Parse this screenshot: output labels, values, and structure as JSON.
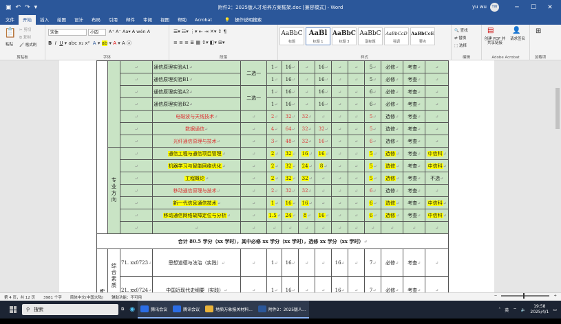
{
  "titlebar": {
    "title": "附件2：2025版人才培养方案框架.doc [兼容模式] - Word",
    "user": "yu wu",
    "avatar": "YW",
    "quick_icons": [
      "save-icon",
      "undo-icon",
      "redo-icon",
      "customize-icon"
    ]
  },
  "tabs": [
    "文件",
    "开始",
    "插入",
    "绘图",
    "设计",
    "布局",
    "引用",
    "邮件",
    "审阅",
    "视图",
    "帮助",
    "Acrobat"
  ],
  "active_tab": "开始",
  "tell_me": "操作说明搜索",
  "ribbon": {
    "clipboard": {
      "paste": "粘贴",
      "cut": "剪切",
      "copy": "复制",
      "format_painter": "格式刷",
      "label": "剪贴板"
    },
    "font": {
      "family": "宋体",
      "size": "小四",
      "label": "字体"
    },
    "paragraph": {
      "label": "段落"
    },
    "styles": {
      "items": [
        {
          "preview": "AaBbC",
          "name": "标题"
        },
        {
          "preview": "AaBl",
          "name": "标题 1"
        },
        {
          "preview": "AaBbC",
          "name": "标题 3"
        },
        {
          "preview": "AaBbC",
          "name": "副标题"
        },
        {
          "preview": "AaBbCcD",
          "name": "强调"
        },
        {
          "preview": "AaBbCcE",
          "name": "要点"
        }
      ],
      "label": "样式"
    },
    "editing": {
      "find": "查找",
      "replace": "替换",
      "select": "选择",
      "label": "编辑"
    },
    "acrobat": {
      "create": "创建 PDF 并共享链接",
      "request": "请求签名",
      "label": "Adobe Acrobat"
    },
    "addins": {
      "label": "加载项"
    }
  },
  "table_rows": [
    {
      "course": "通信原理实验A1",
      "note": "二选一",
      "a": "1",
      "b": "16",
      "c": "",
      "d": "16",
      "e": "",
      "f": "",
      "g": "5",
      "type": "必修",
      "exam": "考查",
      "x": "",
      "color": "dark"
    },
    {
      "course": "通信原理实验B1",
      "note": "",
      "a": "1",
      "b": "16",
      "c": "",
      "d": "16",
      "e": "",
      "f": "",
      "g": "5",
      "type": "必修",
      "exam": "考查",
      "x": "",
      "color": "dark"
    },
    {
      "course": "通信原理实验A2",
      "note": "二选一",
      "a": "1",
      "b": "16",
      "c": "",
      "d": "16",
      "e": "",
      "f": "",
      "g": "6",
      "type": "必修",
      "exam": "考查",
      "x": "",
      "color": "dark"
    },
    {
      "course": "通信原理实验B2",
      "note": "",
      "a": "1",
      "b": "16",
      "c": "",
      "d": "16",
      "e": "",
      "f": "",
      "g": "6",
      "type": "必修",
      "exam": "考查",
      "x": "",
      "color": "dark"
    },
    {
      "course": "电磁波与天线技术",
      "note": "",
      "a": "2",
      "b": "32",
      "c": "32",
      "d": "",
      "e": "",
      "f": "",
      "g": "5",
      "type": "选修",
      "exam": "考查",
      "x": "",
      "color": "red"
    },
    {
      "course": "数据通信",
      "note": "",
      "a": "4",
      "b": "64",
      "c": "32",
      "d": "32",
      "e": "",
      "f": "",
      "g": "5",
      "type": "选修",
      "exam": "考查",
      "x": "",
      "color": "red"
    },
    {
      "course": "光纤通信原理与技术",
      "note": "",
      "a": "3",
      "b": "48",
      "c": "32",
      "d": "16",
      "e": "",
      "f": "",
      "g": "6",
      "type": "选修",
      "exam": "考查",
      "x": "",
      "color": "red"
    },
    {
      "course": "通信工程与通信项目管理",
      "note": "",
      "a": "2",
      "b": "32",
      "c": "16",
      "d": "16",
      "e": "",
      "f": "",
      "g": "5",
      "type": "选修",
      "exam": "考查",
      "x": "中信科",
      "color": "hl"
    },
    {
      "course": "机器学习与智能网络优化",
      "note": "",
      "a": "2",
      "b": "32",
      "c": "24",
      "d": "8",
      "e": "",
      "f": "",
      "g": "5",
      "type": "选修",
      "exam": "考查",
      "x": "中信科",
      "color": "hl"
    },
    {
      "course": "工程概论",
      "note": "",
      "a": "2",
      "b": "32",
      "c": "32",
      "d": "",
      "e": "",
      "f": "",
      "g": "5",
      "type": "选修",
      "exam": "考查",
      "x": "不选",
      "color": "hl"
    },
    {
      "course": "移动通信原理与技术",
      "note": "",
      "a": "2",
      "b": "32",
      "c": "32",
      "d": "",
      "e": "",
      "f": "",
      "g": "6",
      "type": "选修",
      "exam": "考查",
      "x": "",
      "color": "red"
    },
    {
      "course": "新一代信息通信技术",
      "note": "",
      "a": "1",
      "b": "16",
      "c": "16",
      "d": "",
      "e": "",
      "f": "",
      "g": "6",
      "type": "选修",
      "exam": "考查",
      "x": "中信科",
      "color": "hl"
    },
    {
      "course": "移动通信网络故障定位与分析",
      "note": "",
      "a": "1.5",
      "b": "24",
      "c": "8",
      "d": "16",
      "e": "",
      "f": "",
      "g": "6",
      "type": "选修",
      "exam": "考查",
      "x": "中信科",
      "color": "hl"
    },
    {
      "course": "",
      "note": "",
      "a": "",
      "b": "",
      "c": "",
      "d": "",
      "e": "",
      "f": "",
      "g": "",
      "type": "",
      "exam": "",
      "x": "",
      "color": "dark"
    }
  ],
  "category_label": "专业方向",
  "summary": "合计 80.5 学分（xx 学时），其中必修 xx 学分（xx 学时），选修 xx 学分（xx 学时）",
  "practice": {
    "section": "实践",
    "group": "综合素质",
    "rows": [
      {
        "code": "71. xx0723",
        "course": "思想道德与法治（实践）",
        "a": "1",
        "b": "16",
        "c": "",
        "d": "",
        "e": "16",
        "g": "7",
        "type": "必修",
        "exam": "考查"
      },
      {
        "code": "21. xx0724",
        "course": "中国近现代史纲要（实践）",
        "a": "1",
        "b": "16",
        "c": "",
        "d": "",
        "e": "16",
        "g": "7",
        "type": "必修",
        "exam": "考查"
      }
    ]
  },
  "status": {
    "page": "第 4 页，共 12 页",
    "words": "3981 个字",
    "lang": "简体中文(中国大陆)",
    "access": "辅助功能：不可用"
  },
  "taskbar": {
    "search": "搜索",
    "apps": [
      {
        "label": "腾讯会议",
        "color": "#2b6de5"
      },
      {
        "label": "腾讯会议",
        "color": "#2b6de5"
      },
      {
        "label": "地质万象报关材料...",
        "color": "#e8b23a"
      },
      {
        "label": "附件2：2025版人...",
        "color": "#2b579a"
      }
    ],
    "ime": "英",
    "time": "19:58",
    "date": "2025/4/1"
  }
}
